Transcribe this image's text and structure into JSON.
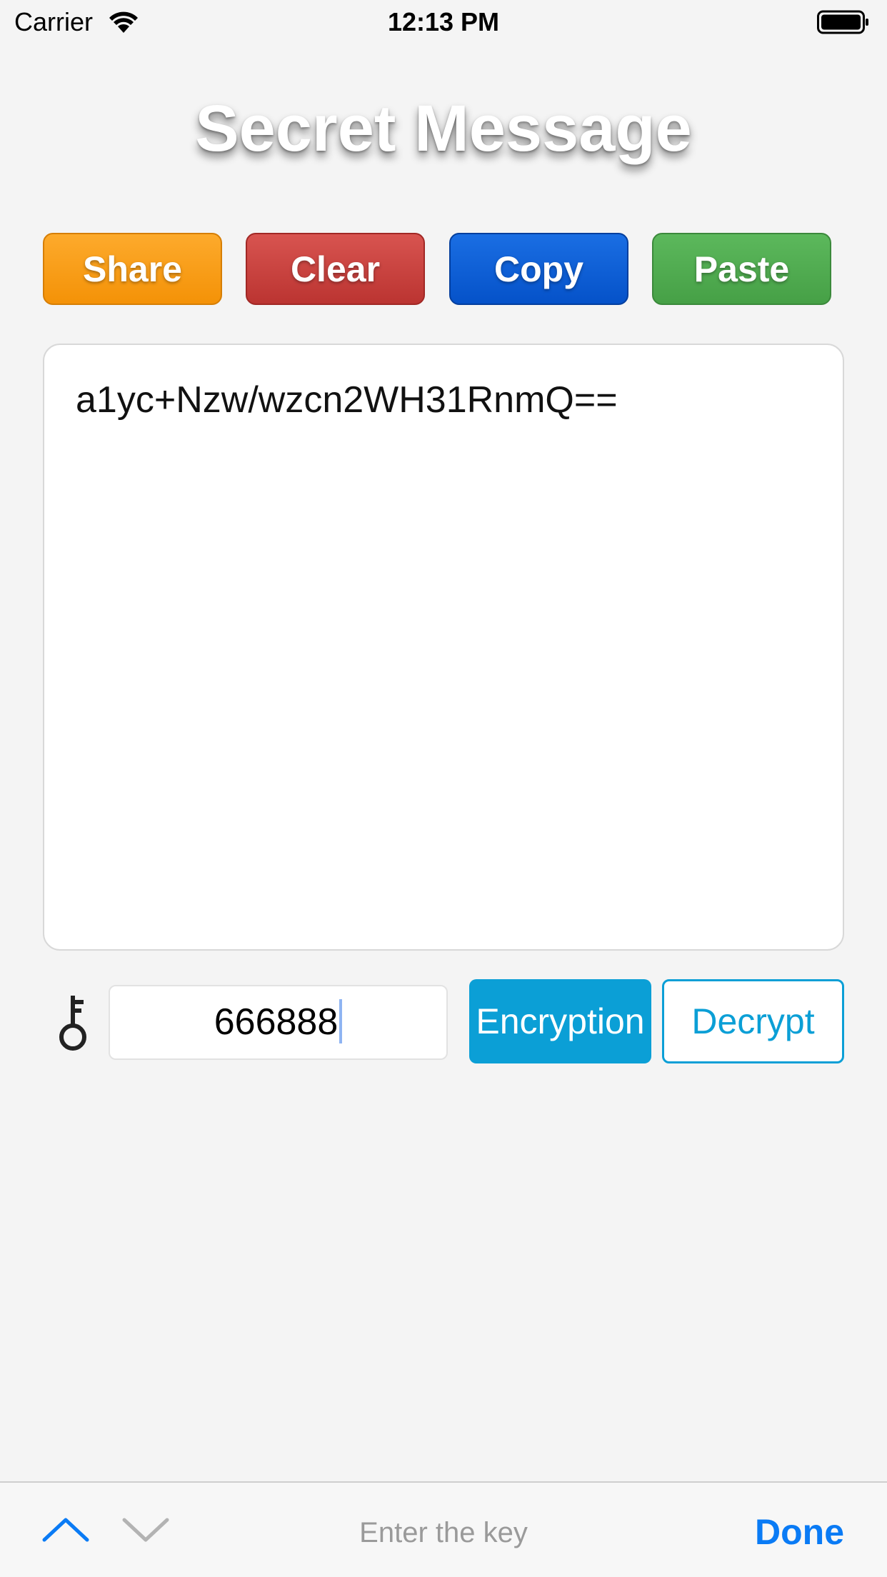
{
  "status_bar": {
    "carrier": "Carrier",
    "time": "12:13 PM"
  },
  "title": "Secret Message",
  "actions": {
    "share": "Share",
    "clear": "Clear",
    "copy": "Copy",
    "paste": "Paste"
  },
  "message": {
    "text": "a1yc+Nzw/wzcn2WH31RnmQ=="
  },
  "key": {
    "value": "666888"
  },
  "crypto": {
    "encrypt_label": "Encryption",
    "decrypt_label": "Decrypt"
  },
  "toolbar": {
    "hint": "Enter the key",
    "done": "Done"
  },
  "colors": {
    "share": "#f49207",
    "clear": "#bb3431",
    "copy": "#0552c9",
    "paste": "#46a046",
    "accent": "#0b9fd6",
    "done": "#0a7bf5"
  },
  "icons": [
    "wifi-icon",
    "battery-icon",
    "key-icon",
    "chevron-up-icon",
    "chevron-down-icon"
  ]
}
